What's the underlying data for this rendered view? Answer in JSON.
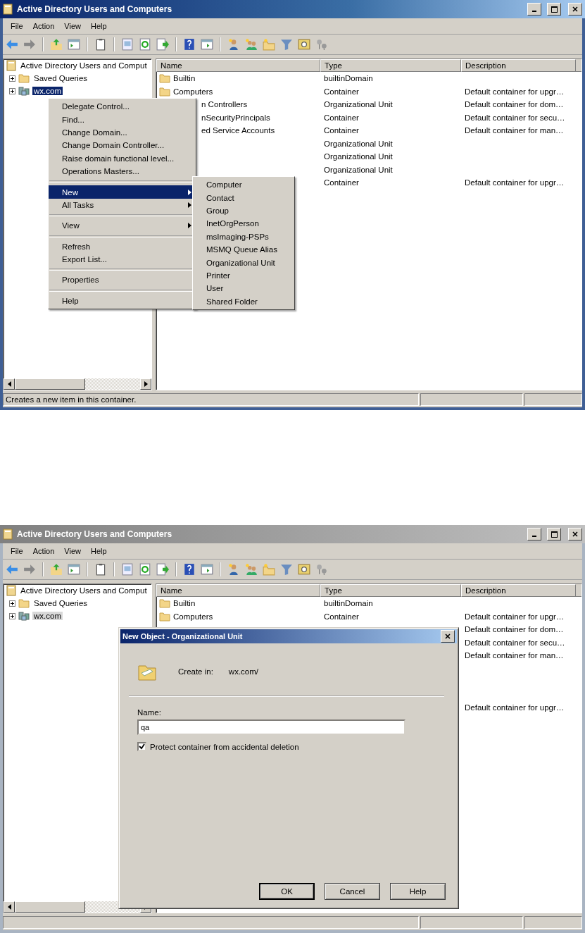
{
  "windows": [
    {
      "title": "Active Directory Users and Computers",
      "active": true,
      "menu_bar": [
        "File",
        "Action",
        "View",
        "Help"
      ],
      "tree": [
        {
          "label": "Active Directory Users and Comput",
          "selected": false,
          "children": [
            {
              "label": "Saved Queries",
              "selected": false
            },
            {
              "label": "wx.com",
              "selected": true
            }
          ]
        }
      ],
      "list": {
        "columns": [
          "Name",
          "Type",
          "Description"
        ],
        "rows": [
          {
            "kind": "full",
            "name": "Builtin",
            "type": "builtinDomain"
          },
          {
            "kind": "full",
            "name": "Computers",
            "type": "Container",
            "description": "Default container for upgr…"
          },
          {
            "kind": "partial",
            "name": "n Controllers",
            "type": "Organizational Unit",
            "description": "Default container for dom…"
          },
          {
            "kind": "partial",
            "name": "nSecurityPrincipals",
            "type": "Container",
            "description": "Default container for secu…"
          },
          {
            "kind": "partial",
            "name": "ed Service Accounts",
            "type": "Container",
            "description": "Default container for man…"
          },
          {
            "kind": "hidden",
            "type": "Organizational Unit"
          },
          {
            "kind": "hidden",
            "type": "Organizational Unit"
          },
          {
            "kind": "hidden",
            "type": "Organizational Unit"
          },
          {
            "kind": "hidden",
            "type": "Container",
            "description": "Default container for upgr…"
          }
        ]
      },
      "status_bar": [
        "Creates a new item in this container."
      ],
      "context_menu": {
        "items": [
          {
            "kind": "item",
            "label": "Delegate Control...",
            "submenu": false,
            "selected": false
          },
          {
            "kind": "item",
            "label": "Find...",
            "submenu": false,
            "selected": false
          },
          {
            "kind": "item",
            "label": "Change Domain...",
            "submenu": false,
            "selected": false
          },
          {
            "kind": "item",
            "label": "Change Domain Controller...",
            "submenu": false,
            "selected": false
          },
          {
            "kind": "item",
            "label": "Raise domain functional level...",
            "submenu": false,
            "selected": false
          },
          {
            "kind": "item",
            "label": "Operations Masters...",
            "submenu": false,
            "selected": false
          },
          {
            "kind": "separator"
          },
          {
            "kind": "item",
            "label": "New",
            "submenu": true,
            "selected": true
          },
          {
            "kind": "item",
            "label": "All Tasks",
            "submenu": true,
            "selected": false
          },
          {
            "kind": "separator"
          },
          {
            "kind": "item",
            "label": "View",
            "submenu": true,
            "selected": false
          },
          {
            "kind": "separator"
          },
          {
            "kind": "item",
            "label": "Refresh",
            "submenu": false,
            "selected": false
          },
          {
            "kind": "item",
            "label": "Export List...",
            "submenu": false,
            "selected": false
          },
          {
            "kind": "separator"
          },
          {
            "kind": "item",
            "label": "Properties",
            "submenu": false,
            "selected": false
          },
          {
            "kind": "separator"
          },
          {
            "kind": "item",
            "label": "Help",
            "submenu": false,
            "selected": false
          }
        ],
        "submenu": {
          "items": [
            {
              "kind": "item",
              "label": "Computer",
              "submenu": false,
              "selected": false
            },
            {
              "kind": "item",
              "label": "Contact",
              "submenu": false,
              "selected": false
            },
            {
              "kind": "item",
              "label": "Group",
              "submenu": false,
              "selected": false
            },
            {
              "kind": "item",
              "label": "InetOrgPerson",
              "submenu": false,
              "selected": false
            },
            {
              "kind": "item",
              "label": "msImaging-PSPs",
              "submenu": false,
              "selected": false
            },
            {
              "kind": "item",
              "label": "MSMQ Queue Alias",
              "submenu": false,
              "selected": false
            },
            {
              "kind": "item",
              "label": "Organizational Unit",
              "submenu": false,
              "selected": false
            },
            {
              "kind": "item",
              "label": "Printer",
              "submenu": false,
              "selected": false
            },
            {
              "kind": "item",
              "label": "User",
              "submenu": false,
              "selected": false
            },
            {
              "kind": "item",
              "label": "Shared Folder",
              "submenu": false,
              "selected": false
            }
          ]
        }
      }
    },
    {
      "title": "Active Directory Users and Computers",
      "active": false,
      "menu_bar": [
        "File",
        "Action",
        "View",
        "Help"
      ],
      "tree": [
        {
          "label": "Active Directory Users and Comput",
          "selected": false,
          "children": [
            {
              "label": "Saved Queries",
              "selected": false
            },
            {
              "label": "wx.com",
              "selected": true
            }
          ]
        }
      ],
      "list": {
        "columns": [
          "Name",
          "Type",
          "Description"
        ],
        "rows": [
          {
            "kind": "full",
            "name": "Builtin",
            "type": "builtinDomain"
          },
          {
            "kind": "full",
            "name": "Computers",
            "type": "Container",
            "description": "Default container for upgr…"
          },
          {
            "kind": "hidden",
            "description": "Default container for dom…"
          },
          {
            "kind": "hidden",
            "description": "Default container for secu…"
          },
          {
            "kind": "hidden",
            "description": "Default container for man…"
          },
          {
            "kind": "hidden"
          },
          {
            "kind": "hidden"
          },
          {
            "kind": "hidden"
          },
          {
            "kind": "hidden",
            "description": "Default container for upgr…"
          }
        ]
      },
      "dialog": {
        "title": "New Object - Organizational Unit",
        "create_in_label": "Create in:",
        "create_in_value": "wx.com/",
        "name_label": "Name:",
        "name_value": "qa",
        "protect": {
          "label": "Protect container from accidental deletion",
          "checked": true
        },
        "buttons": [
          {
            "label": "OK",
            "default": true
          },
          {
            "label": "Cancel",
            "default": false
          },
          {
            "label": "Help",
            "default": false
          }
        ]
      }
    }
  ]
}
